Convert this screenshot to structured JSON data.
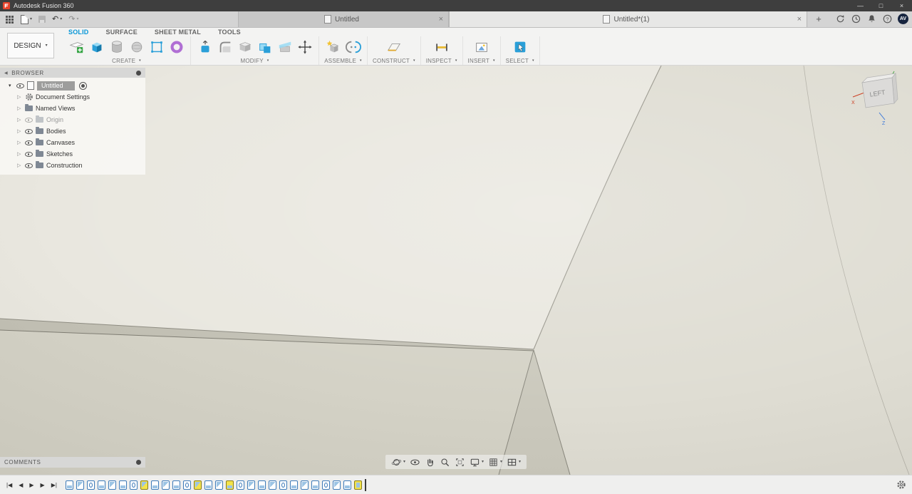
{
  "window": {
    "app_title": "Autodesk Fusion 360",
    "minimize": "—",
    "maximize": "□",
    "close": "×"
  },
  "quickbar": {
    "undo": "↶",
    "redo": "↷"
  },
  "ui": {
    "caret": "▾",
    "expander_open": "▾",
    "expander_closed": "▷"
  },
  "tabs": {
    "close_glyph": "×",
    "add_glyph": "+",
    "items": [
      {
        "label": "Untitled"
      },
      {
        "label": "Untitled*(1)"
      }
    ],
    "avatar": "AV"
  },
  "icons": {
    "help": "?"
  },
  "ribbon": {
    "design_label": "DESIGN",
    "tabs": [
      {
        "label": "SOLID"
      },
      {
        "label": "SURFACE"
      },
      {
        "label": "SHEET METAL"
      },
      {
        "label": "TOOLS"
      }
    ],
    "groups": [
      {
        "label": "CREATE"
      },
      {
        "label": "MODIFY"
      },
      {
        "label": "ASSEMBLE"
      },
      {
        "label": "CONSTRUCT"
      },
      {
        "label": "INSPECT"
      },
      {
        "label": "INSERT"
      },
      {
        "label": "SELECT"
      }
    ]
  },
  "browser": {
    "title": "BROWSER",
    "collapse_glyph": "◀",
    "root_label": "Untitled",
    "items": [
      {
        "label": "Document Settings"
      },
      {
        "label": "Named Views"
      },
      {
        "label": "Origin"
      },
      {
        "label": "Bodies"
      },
      {
        "label": "Canvases"
      },
      {
        "label": "Sketches"
      },
      {
        "label": "Construction"
      }
    ]
  },
  "viewcube": {
    "face_label": "LEFT",
    "axis_x": "X",
    "axis_z": "Z"
  },
  "comments": {
    "title": "COMMENTS"
  },
  "timeline": {
    "controls": [
      "|◀",
      "◀",
      "▶",
      "▶",
      "▶|"
    ],
    "icons": [
      {
        "cls": "t0"
      },
      {
        "cls": "t1"
      },
      {
        "cls": "t2"
      },
      {
        "cls": "t0"
      },
      {
        "cls": "t1"
      },
      {
        "cls": "t0"
      },
      {
        "cls": "t2"
      },
      {
        "cls": "t1 hl"
      },
      {
        "cls": "t0"
      },
      {
        "cls": "t1"
      },
      {
        "cls": "t0"
      },
      {
        "cls": "t2"
      },
      {
        "cls": "t1 hl"
      },
      {
        "cls": "t0"
      },
      {
        "cls": "t1"
      },
      {
        "cls": "t0 hl"
      },
      {
        "cls": "t2"
      },
      {
        "cls": "t1"
      },
      {
        "cls": "t0"
      },
      {
        "cls": "t1"
      },
      {
        "cls": "t2"
      },
      {
        "cls": "t0"
      },
      {
        "cls": "t1"
      },
      {
        "cls": "t0"
      },
      {
        "cls": "t2"
      },
      {
        "cls": "t1"
      },
      {
        "cls": "t0"
      },
      {
        "cls": "t3 hl"
      }
    ]
  },
  "colors": {
    "accent": "#0696d7",
    "highlight": "#f2e34c",
    "avatar": "#16243f",
    "face-top": "#e9e7df",
    "face-right": "#dfddd3",
    "face-band": "#c2c0b4",
    "face-bl": "#d4d2c6",
    "face-tri": "#cbc9bd"
  }
}
